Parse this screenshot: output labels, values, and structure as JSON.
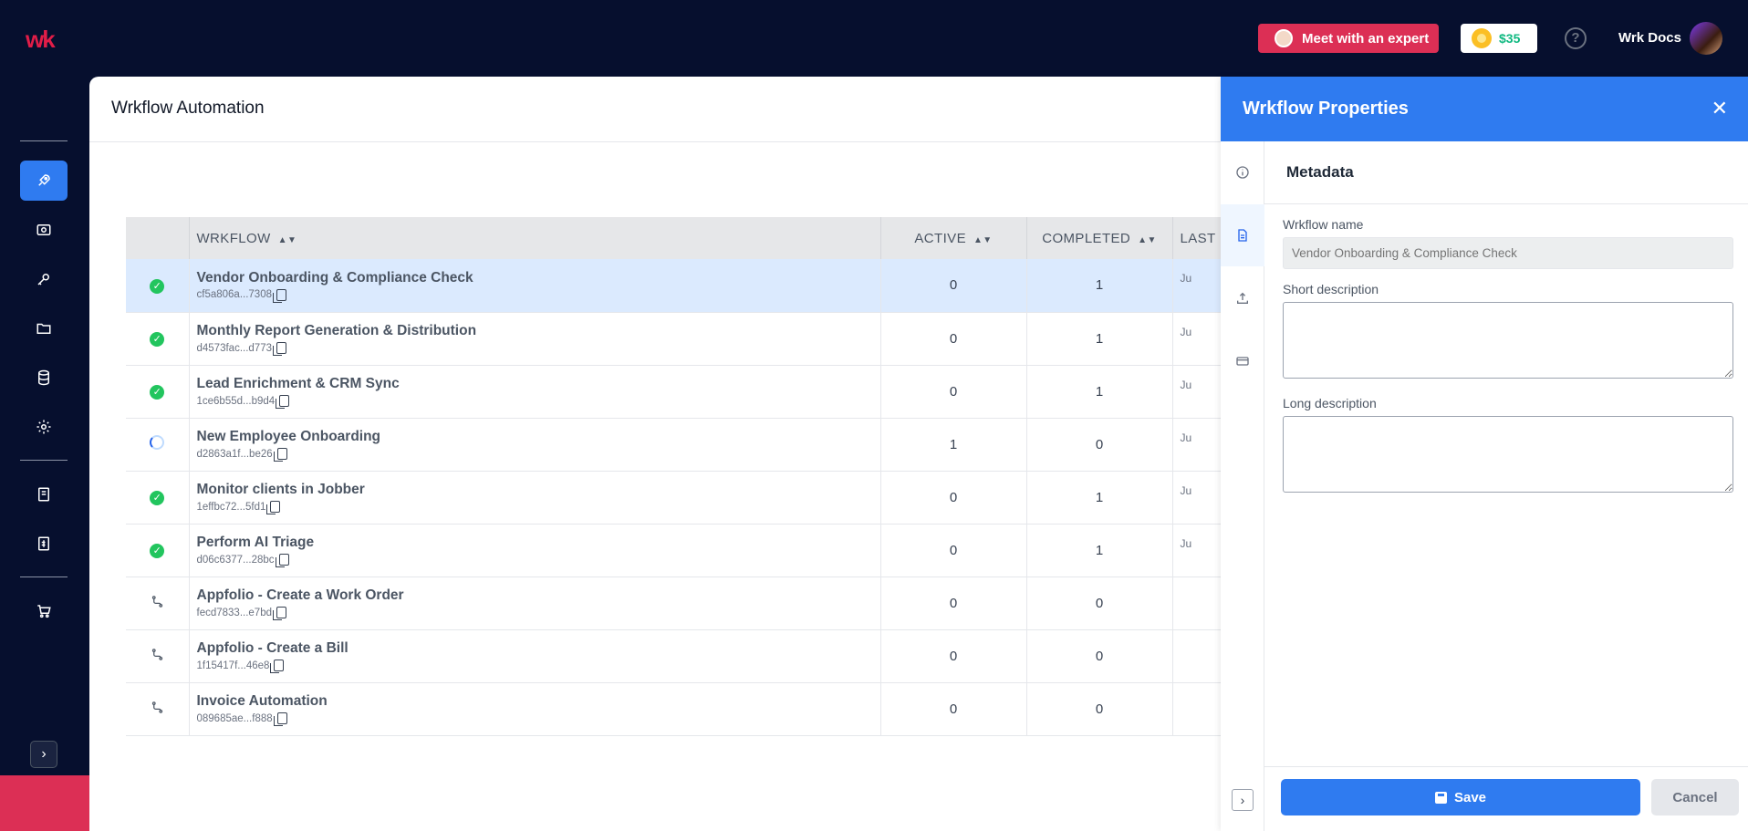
{
  "topbar": {
    "brand": "wk",
    "expert_button": "Meet with an expert",
    "credits": "$35",
    "help": "?",
    "user_name": "Wrk Docs"
  },
  "main": {
    "title": "Wrkflow Automation",
    "columns": {
      "workflow": "WRKFLOW",
      "active": "ACTIVE",
      "completed": "COMPLETED",
      "last": "LAST"
    },
    "rows": [
      {
        "status": "completed",
        "name": "Vendor Onboarding & Compliance Check",
        "id": "cf5a806a...7308",
        "active": "0",
        "completed": "1",
        "last": "Ju",
        "selected": true
      },
      {
        "status": "completed",
        "name": "Monthly Report Generation & Distribution",
        "id": "d4573fac...d773",
        "active": "0",
        "completed": "1",
        "last": "Ju"
      },
      {
        "status": "completed",
        "name": "Lead Enrichment & CRM Sync",
        "id": "1ce6b55d...b9d4",
        "active": "0",
        "completed": "1",
        "last": "Ju"
      },
      {
        "status": "running",
        "name": "New Employee Onboarding",
        "id": "d2863a1f...be26",
        "active": "1",
        "completed": "0",
        "last": "Ju"
      },
      {
        "status": "completed",
        "name": "Monitor clients in Jobber",
        "id": "1effbc72...5fd1",
        "active": "0",
        "completed": "1",
        "last": "Ju"
      },
      {
        "status": "completed",
        "name": "Perform AI Triage",
        "id": "d06c6377...28bc",
        "active": "0",
        "completed": "1",
        "last": "Ju"
      },
      {
        "status": "idle",
        "name": "Appfolio - Create a Work Order",
        "id": "fecd7833...e7bd",
        "active": "0",
        "completed": "0",
        "last": ""
      },
      {
        "status": "idle",
        "name": "Appfolio - Create a Bill",
        "id": "1f15417f...46e8",
        "active": "0",
        "completed": "0",
        "last": ""
      },
      {
        "status": "idle",
        "name": "Invoice Automation",
        "id": "089685ae...f888",
        "active": "0",
        "completed": "0",
        "last": ""
      }
    ]
  },
  "properties": {
    "title": "Wrkflow Properties",
    "section": "Metadata",
    "name_label": "Wrkflow name",
    "name_placeholder": "Vendor Onboarding & Compliance Check",
    "short_desc_label": "Short description",
    "long_desc_label": "Long description",
    "save_label": "Save",
    "cancel_label": "Cancel"
  },
  "colors": {
    "accent": "#2f7bf0",
    "brand": "#dc2f55",
    "nav_bg": "#060f2e",
    "success": "#22c55e"
  }
}
